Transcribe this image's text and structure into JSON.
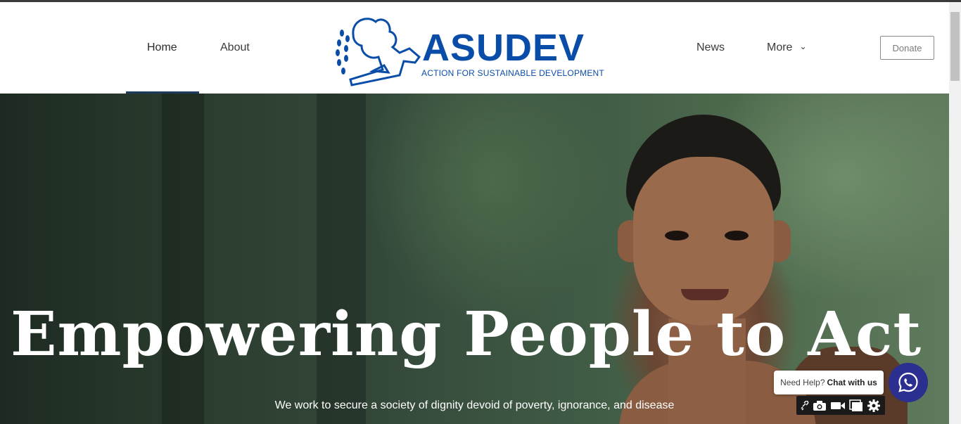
{
  "header": {
    "nav_left": [
      {
        "label": "Home",
        "active": true
      },
      {
        "label": "About",
        "active": false
      }
    ],
    "nav_right": [
      {
        "label": "News"
      },
      {
        "label": "More",
        "icon": "chevron-down-icon"
      }
    ],
    "logo": {
      "wordmark": "ASUDEV",
      "tagline": "ACTION FOR SUSTAINABLE DEVELOPMENT"
    },
    "donate_label": "Donate"
  },
  "hero": {
    "title": "Empowering People to Act",
    "subtitle": "We work to secure a society of dignity devoid of poverty, ignorance, and disease"
  },
  "chat_widget": {
    "prompt": "Need Help?",
    "action": "Chat with us",
    "button_icon": "whatsapp-icon"
  },
  "toolbar_icons": [
    "link-icon",
    "camera-icon",
    "video-icon",
    "window-icon",
    "gear-icon"
  ],
  "colors": {
    "brand_blue": "#0a4da8",
    "active_underline": "#1e3a5f",
    "chat_button": "#2b2f8f"
  }
}
